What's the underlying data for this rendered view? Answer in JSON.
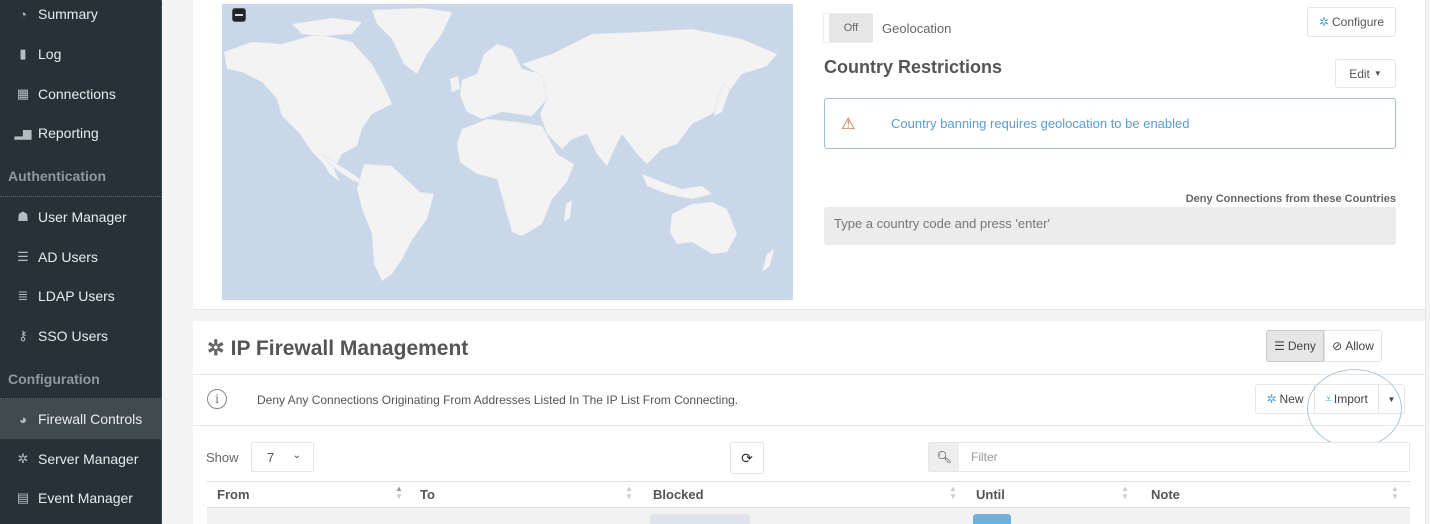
{
  "sidebar": {
    "items": [
      {
        "label": "Summary",
        "icon": "dashboard-icon"
      },
      {
        "label": "Log",
        "icon": "book-icon"
      },
      {
        "label": "Connections",
        "icon": "grid-icon"
      },
      {
        "label": "Reporting",
        "icon": "bar-chart-icon"
      }
    ],
    "section_auth": "Authentication",
    "auth_items": [
      {
        "label": "User Manager",
        "icon": "user-icon"
      },
      {
        "label": "AD Users",
        "icon": "server-icon"
      },
      {
        "label": "LDAP Users",
        "icon": "database-icon"
      },
      {
        "label": "SSO Users",
        "icon": "key-icon"
      }
    ],
    "section_config": "Configuration",
    "config_items": [
      {
        "label": "Firewall Controls",
        "icon": "globe-icon",
        "active": true
      },
      {
        "label": "Server Manager",
        "icon": "gear-icon"
      },
      {
        "label": "Event Manager",
        "icon": "calendar-icon"
      }
    ]
  },
  "geo": {
    "switch_state": "Off",
    "label": "Geolocation",
    "configure_label": "Configure"
  },
  "country": {
    "title": "Country Restrictions",
    "edit_label": "Edit",
    "alert": "Country banning requires geolocation to be enabled",
    "deny_label": "Deny Connections from these Countries",
    "input_placeholder": "Type a country code and press 'enter'"
  },
  "firewall": {
    "title": "IP Firewall Management",
    "deny_label": "Deny",
    "allow_label": "Allow",
    "mode": "Deny",
    "info": "Deny Any Connections Originating From Addresses Listed In The IP List From Connecting.",
    "new_label": "New",
    "import_label": "Import",
    "show_label": "Show",
    "page_size": "7",
    "filter_placeholder": "Filter",
    "columns": [
      "From",
      "To",
      "Blocked",
      "Until",
      "Note"
    ]
  },
  "colors": {
    "sidebar_bg": "#263238",
    "accent": "#5ba2d0",
    "alert_text": "#5b9ccf",
    "map_water": "#c9d7e8",
    "map_land": "#f3f3f3"
  }
}
